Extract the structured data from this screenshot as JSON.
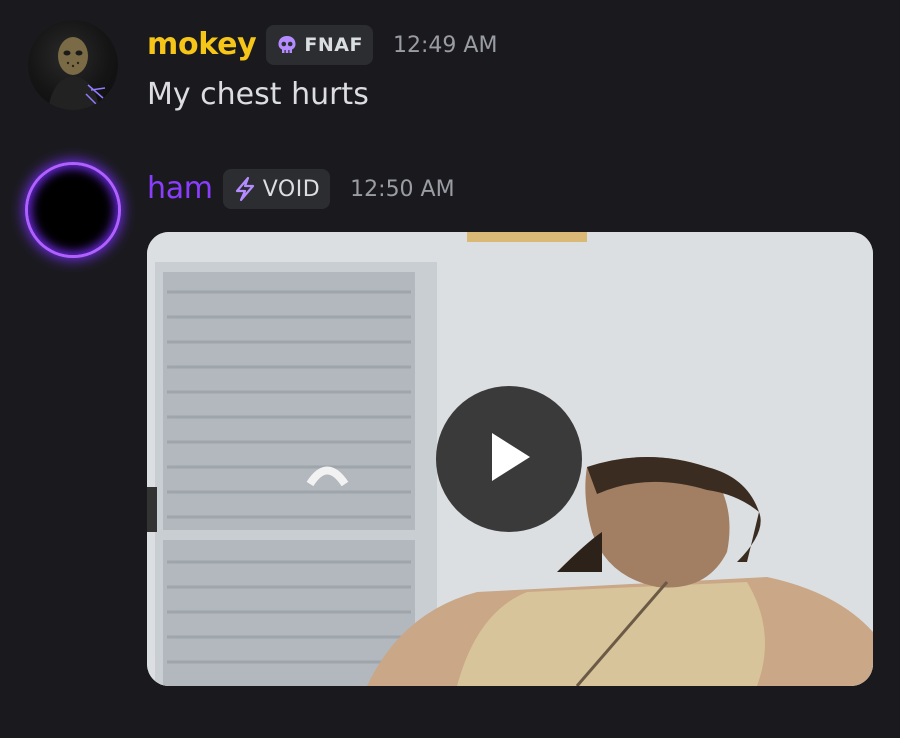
{
  "messages": [
    {
      "username": "mokey",
      "tag": "FNAF",
      "tag_icon": "skull-icon",
      "timestamp": "12:49 AM",
      "text": "My chest hurts",
      "username_color": "#f5c518"
    },
    {
      "username": "ham",
      "tag": "VOID",
      "tag_icon": "lightning-icon",
      "timestamp": "12:50 AM",
      "attachment": "video",
      "username_color": "#8a3dff"
    }
  ],
  "colors": {
    "background": "#1a1a1e",
    "tag_background": "#2b2d31",
    "timestamp": "#9a9ca3",
    "message_text": "#dcdde1",
    "avatar_glow": "#b060ff"
  }
}
